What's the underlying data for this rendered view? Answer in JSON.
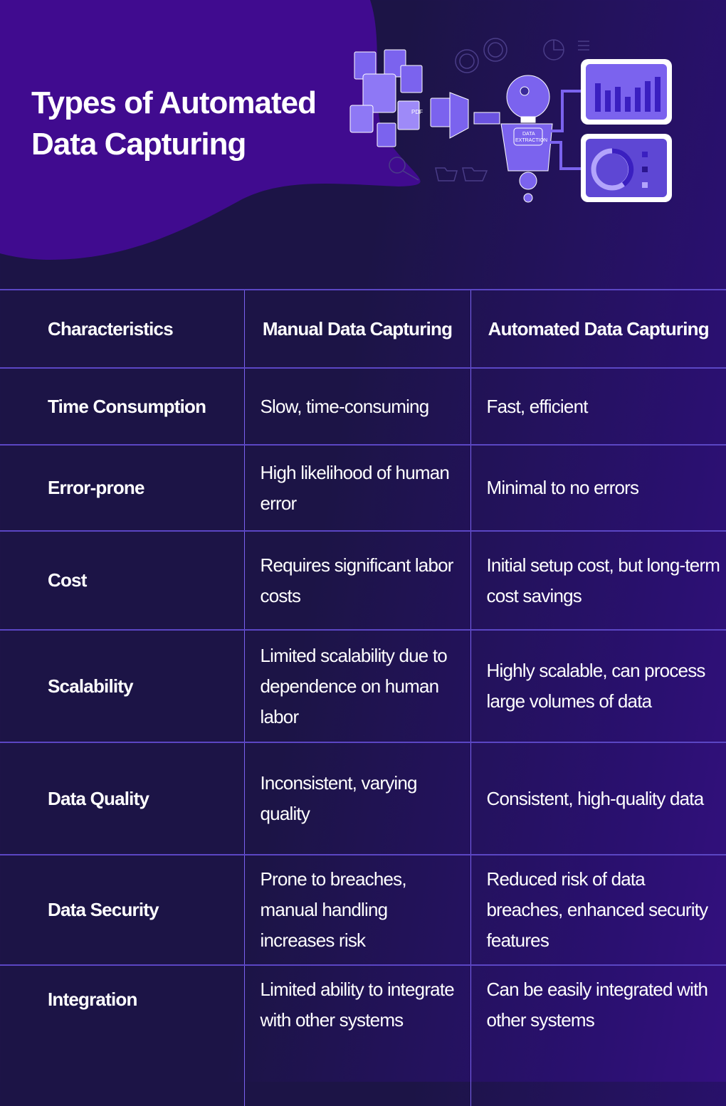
{
  "header": {
    "title_line1": "Types of Automated",
    "title_line2": "Data Capturing",
    "illustration": {
      "robot_badge_line1": "DATA",
      "robot_badge_line2": "EXTRACTION",
      "document_badge": "PDF"
    }
  },
  "colors": {
    "background_dark": "#1c1446",
    "blob_purple": "#400b8f",
    "accent_violet": "#7a62f0",
    "illustration_fill": "#7b63ee",
    "text": "#ffffff"
  },
  "table": {
    "headers": [
      "Characteristics",
      "Manual Data Capturing",
      "Automated Data Capturing"
    ],
    "rows": [
      {
        "characteristic": "Time Consumption",
        "manual": "Slow, time-consuming",
        "automated": "Fast, efficient"
      },
      {
        "characteristic": "Error-prone",
        "manual": "High likelihood of human error",
        "automated": "Minimal to no errors"
      },
      {
        "characteristic": "Cost",
        "manual": "Requires significant labor costs",
        "automated": "Initial setup cost, but long-term cost savings"
      },
      {
        "characteristic": "Scalability",
        "manual": "Limited scalability due to dependence on human labor",
        "automated": "Highly scalable, can process large volumes of data"
      },
      {
        "characteristic": "Data Quality",
        "manual": "Inconsistent, varying quality",
        "automated": "Consistent, high-quality data"
      },
      {
        "characteristic": "Data Security",
        "manual": "Prone to breaches, manual handling increases risk",
        "automated": "Reduced risk of data breaches, enhanced security features"
      },
      {
        "characteristic": "Integration",
        "manual": "Limited ability to integrate with other systems",
        "automated": "Can be easily integrated with other systems"
      }
    ]
  }
}
